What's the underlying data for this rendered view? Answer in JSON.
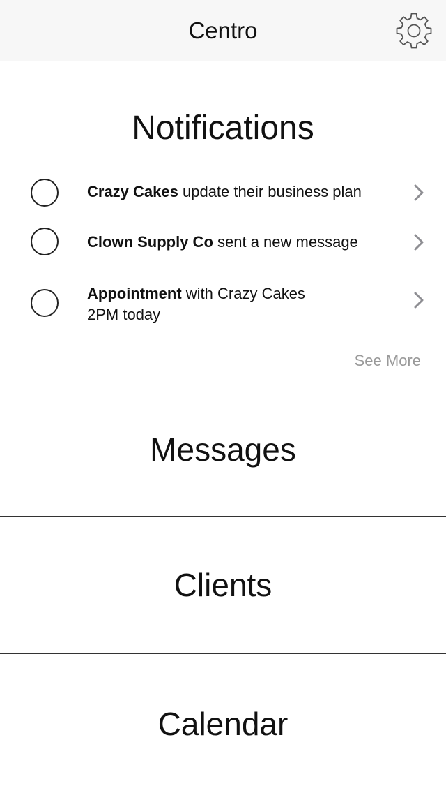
{
  "navbar": {
    "title": "Centro",
    "settings_icon": "gear-icon"
  },
  "notifications": {
    "title": "Notifications",
    "items": [
      {
        "bold": "Crazy Cakes",
        "text": " update their business plan",
        "line2": ""
      },
      {
        "bold": "Clown Supply Co",
        "text": " sent a new message",
        "line2": ""
      },
      {
        "bold": "Appointment",
        "text": " with Crazy Cakes",
        "line2": "2PM today"
      }
    ],
    "see_more": "See More"
  },
  "sections": {
    "messages": "Messages",
    "clients": "Clients",
    "calendar": "Calendar"
  },
  "colors": {
    "navbar_bg": "#f7f7f7",
    "text": "#111111",
    "muted": "#999999",
    "chevron": "#8e8e93"
  }
}
